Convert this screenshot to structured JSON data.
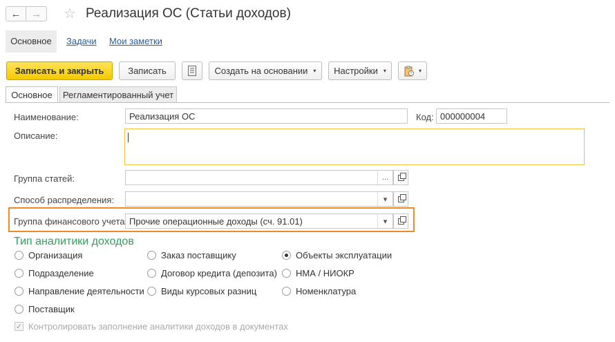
{
  "header": {
    "back_icon": "←",
    "forward_icon": "→",
    "star_icon": "☆",
    "title": "Реализация ОС (Статьи доходов)"
  },
  "nav_tabs": {
    "main": "Основное",
    "tasks": "Задачи",
    "notes": "Мои заметки"
  },
  "toolbar": {
    "save_close": "Записать и закрыть",
    "save": "Записать",
    "create_based": "Создать на основании",
    "settings": "Настройки",
    "caret": "▾"
  },
  "form_tabs": {
    "main": "Основное",
    "regulated": "Регламентированный учет"
  },
  "form": {
    "name_label": "Наименование:",
    "name_value": "Реализация ОС",
    "code_label": "Код:",
    "code_value": "000000004",
    "description_label": "Описание:",
    "description_value": "",
    "group_label": "Группа статей:",
    "group_value": "",
    "distribution_label": "Способ распределения:",
    "distribution_value": "",
    "fin_group_label": "Группа финансового учета:",
    "fin_group_value": "Прочие операционные доходы (сч. 91.01)",
    "select_btn": "...",
    "dropdown_btn": "▾"
  },
  "analytics": {
    "title": "Тип аналитики доходов",
    "options": [
      {
        "label": "Организация",
        "checked": false
      },
      {
        "label": "Подразделение",
        "checked": false
      },
      {
        "label": "Направление деятельности",
        "checked": false
      },
      {
        "label": "Поставщик",
        "checked": false
      },
      {
        "label": "Заказ поставщику",
        "checked": false
      },
      {
        "label": "Договор кредита (депозита)",
        "checked": false
      },
      {
        "label": "Виды курсовых разниц",
        "checked": false
      },
      {
        "label": "Объекты эксплуатации",
        "checked": true
      },
      {
        "label": "НМА / НИОКР",
        "checked": false
      },
      {
        "label": "Номенклатура",
        "checked": false
      }
    ],
    "control_label": "Контролировать заполнение аналитики доходов в документах",
    "control_checked": true
  },
  "colors": {
    "accent_yellow": "#f5c900",
    "highlight_orange": "#f08a24",
    "section_green": "#2ea05a",
    "link_blue": "#1f5fa8"
  }
}
